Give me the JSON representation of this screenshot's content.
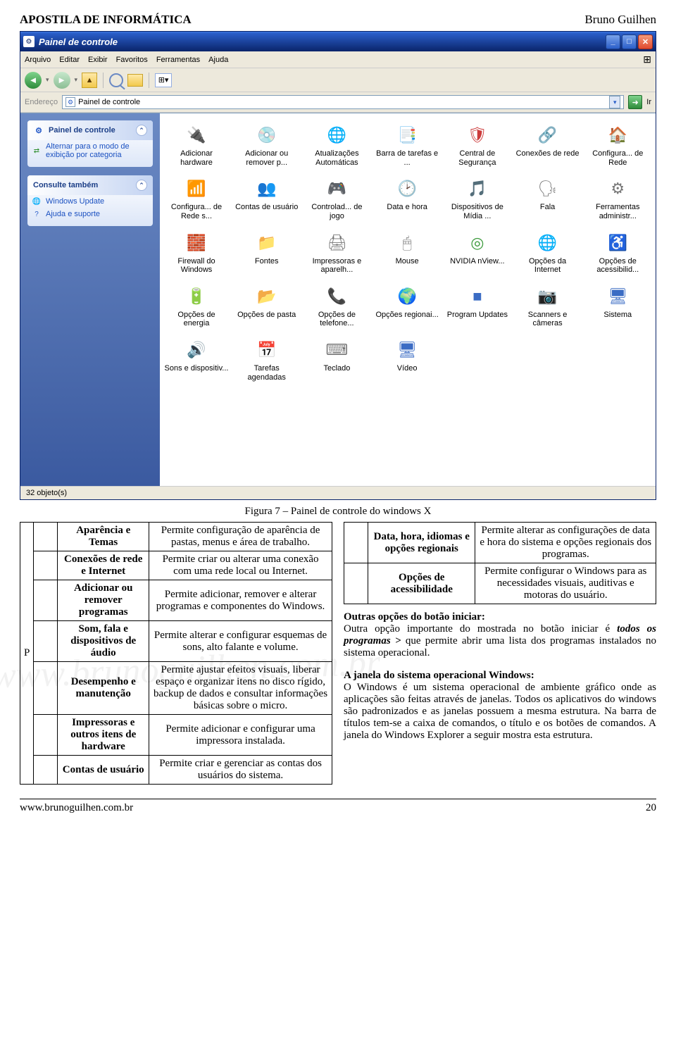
{
  "header": {
    "left": "APOSTILA DE INFORMÁTICA",
    "right": "Bruno Guilhen"
  },
  "window": {
    "title": "Painel de controle",
    "menus": [
      "Arquivo",
      "Editar",
      "Exibir",
      "Favoritos",
      "Ferramentas",
      "Ajuda"
    ],
    "address_label": "Endereço",
    "address_value": "Painel de controle",
    "go_label": "Ir",
    "status": "32 objeto(s)"
  },
  "sidebar": {
    "panel1": {
      "title": "Painel de controle",
      "link": "Alternar para o modo de exibição por categoria"
    },
    "panel2": {
      "title": "Consulte também",
      "links": [
        "Windows Update",
        "Ajuda e suporte"
      ]
    }
  },
  "items": [
    {
      "label": "Adicionar hardware",
      "glyph": "🔌",
      "cls": "ic-blue"
    },
    {
      "label": "Adicionar ou remover p...",
      "glyph": "💿",
      "cls": "ic-green"
    },
    {
      "label": "Atualizações Automáticas",
      "glyph": "🌐",
      "cls": "ic-blue"
    },
    {
      "label": "Barra de tarefas e ...",
      "glyph": "📑",
      "cls": "ic-blue"
    },
    {
      "label": "Central de Segurança",
      "glyph": "🛡",
      "cls": "ic-red"
    },
    {
      "label": "Conexões de rede",
      "glyph": "🔗",
      "cls": "ic-blue"
    },
    {
      "label": "Configura... de Rede",
      "glyph": "🏠",
      "cls": "ic-orange"
    },
    {
      "label": "Configura... de Rede s...",
      "glyph": "📶",
      "cls": "ic-blue"
    },
    {
      "label": "Contas de usuário",
      "glyph": "👥",
      "cls": "ic-green"
    },
    {
      "label": "Controlad... de jogo",
      "glyph": "🎮",
      "cls": "ic-gray"
    },
    {
      "label": "Data e hora",
      "glyph": "🕑",
      "cls": "ic-blue"
    },
    {
      "label": "Dispositivos de Mídia ...",
      "glyph": "🎵",
      "cls": "ic-blue"
    },
    {
      "label": "Fala",
      "glyph": "🗣",
      "cls": "ic-gray"
    },
    {
      "label": "Ferramentas administr...",
      "glyph": "⚙",
      "cls": "ic-gray"
    },
    {
      "label": "Firewall do Windows",
      "glyph": "🧱",
      "cls": "ic-orange"
    },
    {
      "label": "Fontes",
      "glyph": "📁",
      "cls": "ic-yellow"
    },
    {
      "label": "Impressoras e aparelh...",
      "glyph": "🖨",
      "cls": "ic-gray"
    },
    {
      "label": "Mouse",
      "glyph": "🖱",
      "cls": "ic-gray"
    },
    {
      "label": "NVIDIA nView...",
      "glyph": "◎",
      "cls": "ic-green"
    },
    {
      "label": "Opções da Internet",
      "glyph": "🌐",
      "cls": "ic-blue"
    },
    {
      "label": "Opções de acessibilid...",
      "glyph": "♿",
      "cls": "ic-green"
    },
    {
      "label": "Opções de energia",
      "glyph": "🔋",
      "cls": "ic-green"
    },
    {
      "label": "Opções de pasta",
      "glyph": "📂",
      "cls": "ic-yellow"
    },
    {
      "label": "Opções de telefone...",
      "glyph": "📞",
      "cls": "ic-blue"
    },
    {
      "label": "Opções regionai...",
      "glyph": "🌍",
      "cls": "ic-blue"
    },
    {
      "label": "Program Updates",
      "glyph": "■",
      "cls": "ic-blue"
    },
    {
      "label": "Scanners e câmeras",
      "glyph": "📷",
      "cls": "ic-gray"
    },
    {
      "label": "Sistema",
      "glyph": "🖥",
      "cls": "ic-blue"
    },
    {
      "label": "Sons e dispositiv...",
      "glyph": "🔊",
      "cls": "ic-gray"
    },
    {
      "label": "Tarefas agendadas",
      "glyph": "📅",
      "cls": "ic-blue"
    },
    {
      "label": "Teclado",
      "glyph": "⌨",
      "cls": "ic-gray"
    },
    {
      "label": "Vídeo",
      "glyph": "🖥",
      "cls": "ic-blue"
    }
  ],
  "figure_caption": "Figura 7 – Painel de controle do windows X",
  "table_left": {
    "side_label": "P",
    "rows": [
      {
        "name": "Aparência e Temas",
        "desc": "Permite configuração de aparência de pastas, menus e área de trabalho."
      },
      {
        "name": "Conexões de rede e Internet",
        "desc": "Permite criar ou alterar uma conexão com uma rede local ou Internet."
      },
      {
        "name": "Adicionar ou remover programas",
        "desc": "Permite adicionar, remover e alterar programas e componentes do Windows."
      },
      {
        "name": "Som, fala e dispositivos de áudio",
        "desc": "Permite alterar e configurar esquemas de sons, alto falante e volume."
      },
      {
        "name": "Desempenho e manutenção",
        "desc": "Permite ajustar efeitos visuais, liberar espaço e organizar itens no disco rígido, backup de dados e consultar informações básicas sobre o micro."
      },
      {
        "name": "Impressoras e outros itens de hardware",
        "desc": "Permite adicionar e configurar uma impressora instalada."
      },
      {
        "name": "Contas de usuário",
        "desc": "Permite criar e gerenciar as contas dos usuários do sistema."
      }
    ]
  },
  "table_right": {
    "rows": [
      {
        "name": "Data, hora, idiomas e opções regionais",
        "desc": "Permite alterar as configurações de data e hora do sistema e opções regionais dos programas."
      },
      {
        "name": "Opções de acessibilidade",
        "desc": "Permite configurar o Windows para as necessidades visuais, auditivas e motoras do usuário."
      }
    ]
  },
  "paragraphs": {
    "outras_title": "Outras opções do botão iniciar:",
    "outras_body_pre": "Outra opção importante do mostrada no botão iniciar é ",
    "outras_body_em": "todos os programas > ",
    "outras_body_post": "que permite abrir uma lista dos programas instalados no sistema operacional.",
    "janela_title": "A janela do sistema operacional Windows:",
    "janela_body": "O Windows é um sistema operacional de ambiente gráfico onde as aplicações são feitas através de janelas. Todos os aplicativos do windows são padronizados e as janelas possuem a mesma estrutura. Na barra de títulos tem-se a caixa de comandos, o título e os botões de comandos. A janela do Windows Explorer a seguir mostra esta estrutura."
  },
  "watermark": "www.brunoguilhen.com.br",
  "footer": {
    "left": "www.brunoguilhen.com.br",
    "page": "20"
  }
}
